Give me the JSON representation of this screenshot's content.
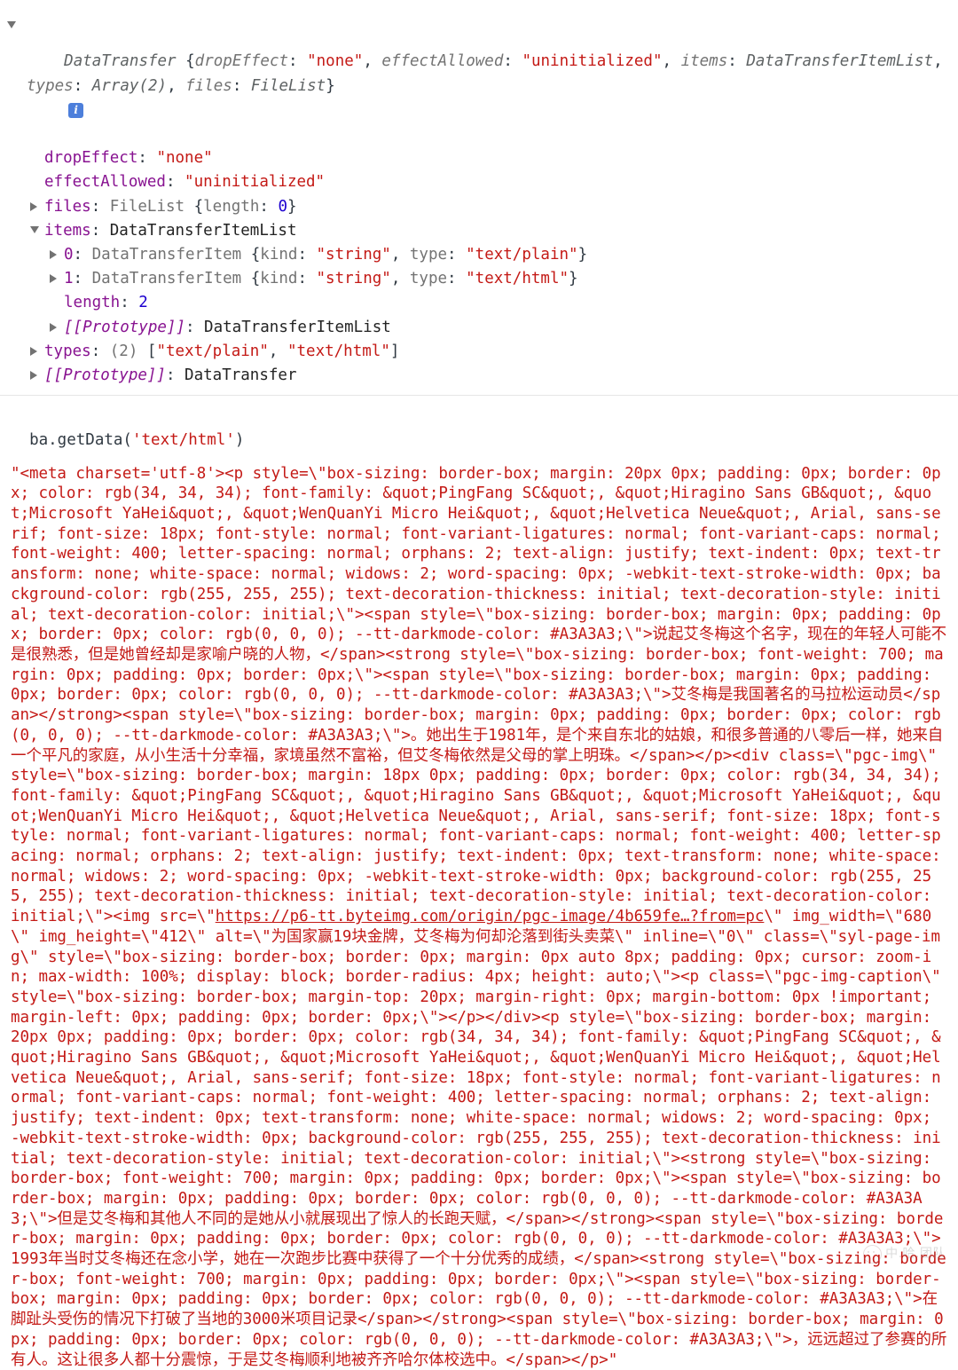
{
  "console": {
    "object_tree": {
      "root": {
        "indent": "root",
        "expanded": true,
        "tokens": [
          {
            "t": "class-i",
            "v": "DataTransfer"
          },
          {
            "t": "punc",
            "v": " {"
          },
          {
            "t": "grey-i",
            "v": "dropEffect"
          },
          {
            "t": "punc",
            "v": ": "
          },
          {
            "t": "str",
            "v": "\"none\""
          },
          {
            "t": "punc",
            "v": ", "
          },
          {
            "t": "grey-i",
            "v": "effectAllowed"
          },
          {
            "t": "punc",
            "v": ": "
          },
          {
            "t": "str",
            "v": "\"uninitialized\""
          },
          {
            "t": "punc",
            "v": ", "
          },
          {
            "t": "grey-i",
            "v": "items"
          },
          {
            "t": "punc",
            "v": ": "
          },
          {
            "t": "class-i",
            "v": "DataTransferItemList"
          },
          {
            "t": "punc",
            "v": ", "
          },
          {
            "t": "grey-i",
            "v": "types"
          },
          {
            "t": "punc",
            "v": ": "
          },
          {
            "t": "class-i",
            "v": "Array(2)"
          },
          {
            "t": "punc",
            "v": ", "
          },
          {
            "t": "grey-i",
            "v": "files"
          },
          {
            "t": "punc",
            "v": ": "
          },
          {
            "t": "class-i",
            "v": "FileList"
          },
          {
            "t": "punc",
            "v": "}"
          }
        ],
        "badge": "i"
      },
      "rows": [
        {
          "name": "row-dropEffect",
          "indent": 1,
          "marker": "none",
          "tokens": [
            {
              "t": "prop",
              "v": "dropEffect"
            },
            {
              "t": "punc",
              "v": ": "
            },
            {
              "t": "str",
              "v": "\"none\""
            }
          ]
        },
        {
          "name": "row-effectAllowed",
          "indent": 1,
          "marker": "none",
          "tokens": [
            {
              "t": "prop",
              "v": "effectAllowed"
            },
            {
              "t": "punc",
              "v": ": "
            },
            {
              "t": "str",
              "v": "\"uninitialized\""
            }
          ]
        },
        {
          "name": "row-files",
          "indent": 1,
          "marker": "right",
          "tokens": [
            {
              "t": "prop",
              "v": "files"
            },
            {
              "t": "punc",
              "v": ": "
            },
            {
              "t": "grey",
              "v": "FileList"
            },
            {
              "t": "punc",
              "v": " {"
            },
            {
              "t": "grey",
              "v": "length"
            },
            {
              "t": "punc",
              "v": ": "
            },
            {
              "t": "num",
              "v": "0"
            },
            {
              "t": "punc",
              "v": "}"
            }
          ]
        },
        {
          "name": "row-items",
          "indent": 1,
          "marker": "down",
          "tokens": [
            {
              "t": "prop",
              "v": "items"
            },
            {
              "t": "punc",
              "v": ": "
            },
            {
              "t": "class",
              "v": "DataTransferItemList"
            }
          ]
        },
        {
          "name": "row-item-0",
          "indent": 2,
          "marker": "right",
          "tokens": [
            {
              "t": "prop",
              "v": "0"
            },
            {
              "t": "punc",
              "v": ": "
            },
            {
              "t": "grey",
              "v": "DataTransferItem"
            },
            {
              "t": "punc",
              "v": " {"
            },
            {
              "t": "grey",
              "v": "kind"
            },
            {
              "t": "punc",
              "v": ": "
            },
            {
              "t": "str",
              "v": "\"string\""
            },
            {
              "t": "punc",
              "v": ", "
            },
            {
              "t": "grey",
              "v": "type"
            },
            {
              "t": "punc",
              "v": ": "
            },
            {
              "t": "str",
              "v": "\"text/plain\""
            },
            {
              "t": "punc",
              "v": "}"
            }
          ]
        },
        {
          "name": "row-item-1",
          "indent": 2,
          "marker": "right",
          "tokens": [
            {
              "t": "prop",
              "v": "1"
            },
            {
              "t": "punc",
              "v": ": "
            },
            {
              "t": "grey",
              "v": "DataTransferItem"
            },
            {
              "t": "punc",
              "v": " {"
            },
            {
              "t": "grey",
              "v": "kind"
            },
            {
              "t": "punc",
              "v": ": "
            },
            {
              "t": "str",
              "v": "\"string\""
            },
            {
              "t": "punc",
              "v": ", "
            },
            {
              "t": "grey",
              "v": "type"
            },
            {
              "t": "punc",
              "v": ": "
            },
            {
              "t": "str",
              "v": "\"text/html\""
            },
            {
              "t": "punc",
              "v": "}"
            }
          ]
        },
        {
          "name": "row-items-length",
          "indent": 2,
          "marker": "none",
          "tokens": [
            {
              "t": "prop",
              "v": "length"
            },
            {
              "t": "punc",
              "v": ": "
            },
            {
              "t": "num",
              "v": "2"
            }
          ]
        },
        {
          "name": "row-items-prototype",
          "indent": 2,
          "marker": "right",
          "tokens": [
            {
              "t": "prop-i",
              "v": "[[Prototype]]"
            },
            {
              "t": "punc",
              "v": ": "
            },
            {
              "t": "class",
              "v": "DataTransferItemList"
            }
          ]
        },
        {
          "name": "row-types",
          "indent": 1,
          "marker": "right",
          "tokens": [
            {
              "t": "prop",
              "v": "types"
            },
            {
              "t": "punc",
              "v": ": "
            },
            {
              "t": "grey",
              "v": "(2)"
            },
            {
              "t": "punc",
              "v": " ["
            },
            {
              "t": "str",
              "v": "\"text/plain\""
            },
            {
              "t": "punc",
              "v": ", "
            },
            {
              "t": "str",
              "v": "\"text/html\""
            },
            {
              "t": "punc",
              "v": "]"
            }
          ]
        },
        {
          "name": "row-root-prototype",
          "indent": 1,
          "marker": "right",
          "tokens": [
            {
              "t": "prop-i",
              "v": "[[Prototype]]"
            },
            {
              "t": "punc",
              "v": ": "
            },
            {
              "t": "class",
              "v": "DataTransfer"
            }
          ]
        }
      ]
    },
    "command": "ba.getData('text/html')",
    "result_parts": [
      {
        "type": "text",
        "v": "\"<meta charset='utf-8'><p style=\\\"box-sizing: border-box; margin: 20px 0px; padding: 0px; border: 0px; color: rgb(34, 34, 34); font-family: &quot;PingFang SC&quot;, &quot;Hiragino Sans GB&quot;, &quot;Microsoft YaHei&quot;, &quot;WenQuanYi Micro Hei&quot;, &quot;Helvetica Neue&quot;, Arial, sans-serif; font-size: 18px; font-style: normal; font-variant-ligatures: normal; font-variant-caps: normal; font-weight: 400; letter-spacing: normal; orphans: 2; text-align: justify; text-indent: 0px; text-transform: none; white-space: normal; widows: 2; word-spacing: 0px; -webkit-text-stroke-width: 0px; background-color: rgb(255, 255, 255); text-decoration-thickness: initial; text-decoration-style: initial; text-decoration-color: initial;\\\"><span style=\\\"box-sizing: border-box; margin: 0px; padding: 0px; border: 0px; color: rgb(0, 0, 0); --tt-darkmode-color: #A3A3A3;\\\">说起艾冬梅这个名字，现在的年轻人可能不是很熟悉，但是她曾经却是家喻户晓的人物，</span><strong style=\\\"box-sizing: border-box; font-weight: 700; margin: 0px; padding: 0px; border: 0px;\\\"><span style=\\\"box-sizing: border-box; margin: 0px; padding: 0px; border: 0px; color: rgb(0, 0, 0); --tt-darkmode-color: #A3A3A3;\\\">艾冬梅是我国著名的马拉松运动员</span></strong><span style=\\\"box-sizing: border-box; margin: 0px; padding: 0px; border: 0px; color: rgb(0, 0, 0); --tt-darkmode-color: #A3A3A3;\\\">。她出生于1981年，是个来自东北的姑娘，和很多普通的八零后一样，她来自一个平凡的家庭，从小生活十分幸福，家境虽然不富裕，但艾冬梅依然是父母的掌上明珠。</span></p><div class=\\\"pgc-img\\\" style=\\\"box-sizing: border-box; margin: 18px 0px; padding: 0px; border: 0px; color: rgb(34, 34, 34); font-family: &quot;PingFang SC&quot;, &quot;Hiragino Sans GB&quot;, &quot;Microsoft YaHei&quot;, &quot;WenQuanYi Micro Hei&quot;, &quot;Helvetica Neue&quot;, Arial, sans-serif; font-size: 18px; font-style: normal; font-variant-ligatures: normal; font-variant-caps: normal; font-weight: 400; letter-spacing: normal; orphans: 2; text-align: justify; text-indent: 0px; text-transform: none; white-space: normal; widows: 2; word-spacing: 0px; -webkit-text-stroke-width: 0px; background-color: rgb(255, 255, 255); text-decoration-thickness: initial; text-decoration-style: initial; text-decoration-color: initial;\\\"><img src=\\\""
      },
      {
        "type": "link",
        "v": "https://p6-tt.byteimg.com/origin/pgc-image/4b659fe…?from=pc"
      },
      {
        "type": "text",
        "v": "\\\" img_width=\\\"680\\\" img_height=\\\"412\\\" alt=\\\"为国家赢19块金牌，艾冬梅为何却沦落到街头卖菜\\\" inline=\\\"0\\\" class=\\\"syl-page-img\\\" style=\\\"box-sizing: border-box; border: 0px; margin: 0px auto 8px; padding: 0px; cursor: zoom-in; max-width: 100%; display: block; border-radius: 4px; height: auto;\\\"><p class=\\\"pgc-img-caption\\\" style=\\\"box-sizing: border-box; margin-top: 20px; margin-right: 0px; margin-bottom: 0px !important; margin-left: 0px; padding: 0px; border: 0px;\\\"></p></div><p style=\\\"box-sizing: border-box; margin: 20px 0px; padding: 0px; border: 0px; color: rgb(34, 34, 34); font-family: &quot;PingFang SC&quot;, &quot;Hiragino Sans GB&quot;, &quot;Microsoft YaHei&quot;, &quot;WenQuanYi Micro Hei&quot;, &quot;Helvetica Neue&quot;, Arial, sans-serif; font-size: 18px; font-style: normal; font-variant-ligatures: normal; font-variant-caps: normal; font-weight: 400; letter-spacing: normal; orphans: 2; text-align: justify; text-indent: 0px; text-transform: none; white-space: normal; widows: 2; word-spacing: 0px; -webkit-text-stroke-width: 0px; background-color: rgb(255, 255, 255); text-decoration-thickness: initial; text-decoration-style: initial; text-decoration-color: initial;\\\"><strong style=\\\"box-sizing: border-box; font-weight: 700; margin: 0px; padding: 0px; border: 0px;\\\"><span style=\\\"box-sizing: border-box; margin: 0px; padding: 0px; border: 0px; color: rgb(0, 0, 0); --tt-darkmode-color: #A3A3A3;\\\">但是艾冬梅和其他人不同的是她从小就展现出了惊人的长跑天赋，</span></strong><span style=\\\"box-sizing: border-box; margin: 0px; padding: 0px; border: 0px; color: rgb(0, 0, 0); --tt-darkmode-color: #A3A3A3;\\\">1993年当时艾冬梅还在念小学，她在一次跑步比赛中获得了一个十分优秀的成绩，</span><strong style=\\\"box-sizing: border-box; font-weight: 700; margin: 0px; padding: 0px; border: 0px;\\\"><span style=\\\"box-sizing: border-box; margin: 0px; padding: 0px; border: 0px; color: rgb(0, 0, 0); --tt-darkmode-color: #A3A3A3;\\\">在脚趾头受伤的情况下打破了当地的3000米项目记录</span></strong><span style=\\\"box-sizing: border-box; margin: 0px; padding: 0px; border: 0px; color: rgb(0, 0, 0); --tt-darkmode-color: #A3A3A3;\\\">，远远超过了参赛的所有人。这让很多人都十分震惊，于是艾冬梅顺利地被齐齐哈尔体校选中。</span></p>\""
      }
    ],
    "watermark": "中.哈.团队"
  }
}
